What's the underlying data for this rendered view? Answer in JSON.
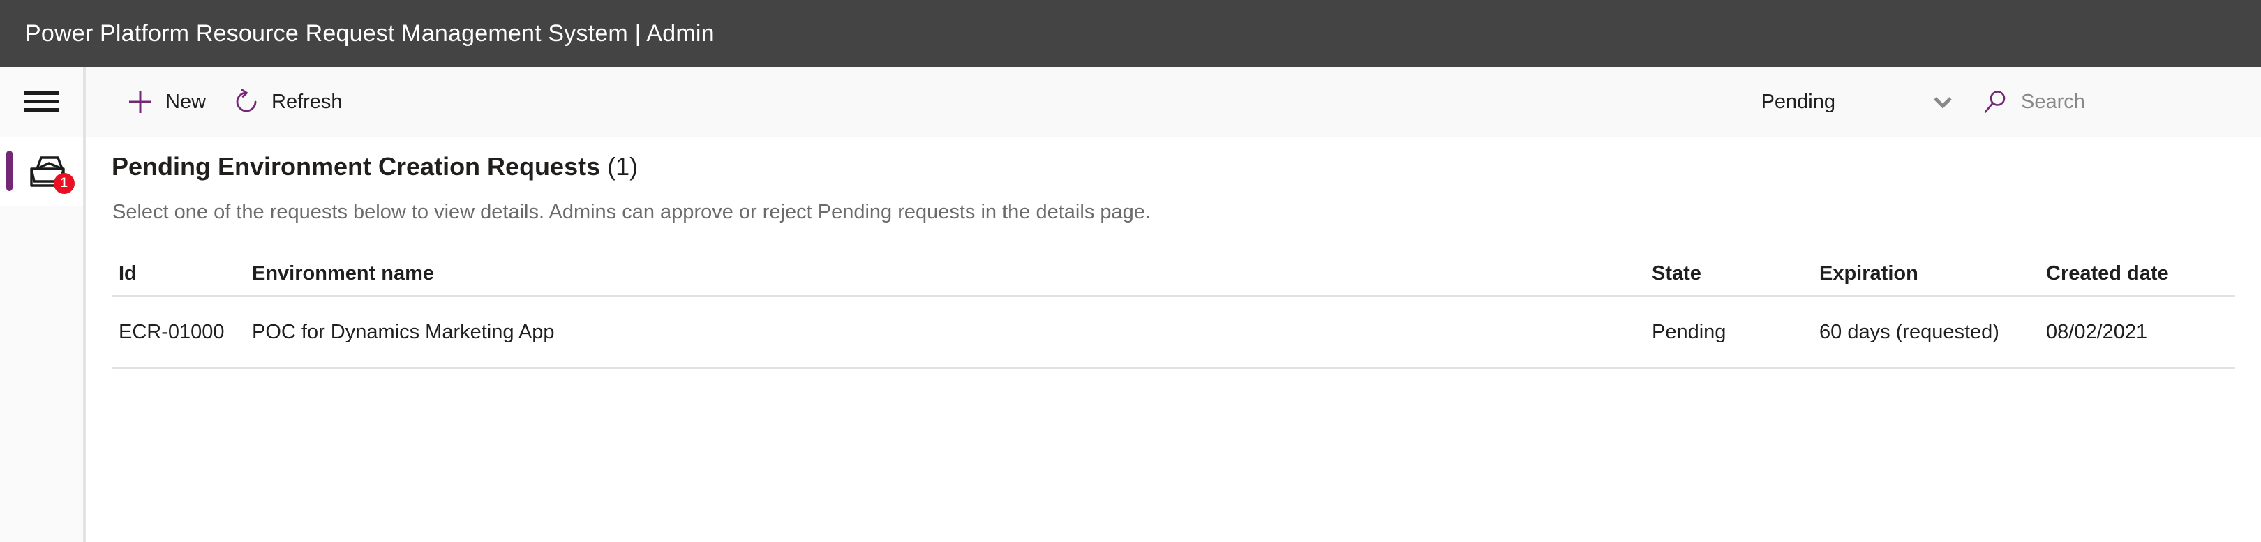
{
  "header": {
    "title": "Power Platform Resource Request Management System | Admin",
    "background": "#444444",
    "text_color": "#ffffff"
  },
  "theme": {
    "accent": "#742774",
    "badge": "#e81123",
    "command_bar_bg": "#f9f9f9",
    "rail_bg": "#fafafa",
    "divider": "#e1e1e1",
    "muted_text": "#6b6b6b"
  },
  "rail": {
    "menu_icon": "hamburger-menu-icon",
    "items": [
      {
        "icon": "inbox-tray-icon",
        "badge": "1",
        "selected": true
      }
    ]
  },
  "commandbar": {
    "new_label": "New",
    "new_icon": "plus-icon",
    "refresh_label": "Refresh",
    "refresh_icon": "refresh-icon",
    "filter": {
      "selected": "Pending",
      "chevron_icon": "chevron-down-icon",
      "options": [
        "Pending"
      ]
    },
    "search": {
      "icon": "search-icon",
      "placeholder": "Search",
      "value": ""
    }
  },
  "main": {
    "title": "Pending Environment Creation Requests",
    "count": "(1)",
    "subtitle": "Select one of the requests below to view details. Admins can approve or reject Pending requests in the details page.",
    "table": {
      "columns": [
        {
          "key": "id",
          "label": "Id"
        },
        {
          "key": "name",
          "label": "Environment name"
        },
        {
          "key": "state",
          "label": "State"
        },
        {
          "key": "expiration",
          "label": "Expiration"
        },
        {
          "key": "created",
          "label": "Created date"
        }
      ],
      "rows": [
        {
          "id": "ECR-01000",
          "name": "POC for Dynamics Marketing App",
          "state": "Pending",
          "expiration": "60 days (requested)",
          "created": "08/02/2021"
        }
      ]
    }
  }
}
